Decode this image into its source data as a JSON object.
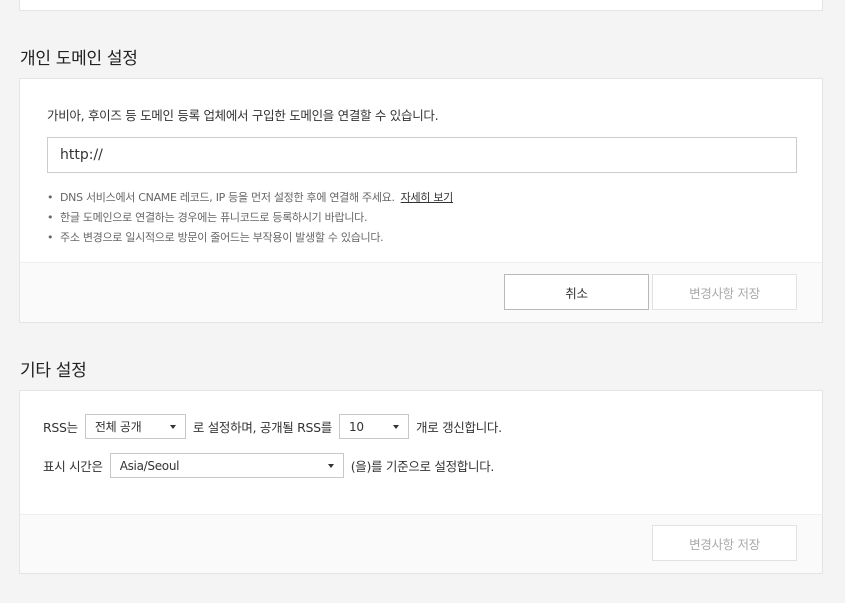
{
  "custom_domain": {
    "title": "개인 도메인 설정",
    "description": "가비아, 후이즈 등 도메인 등록 업체에서 구입한 도메인을 연결할 수 있습니다.",
    "url_value": "http://",
    "notes": [
      "DNS 서비스에서 CNAME 레코드, IP 등을 먼저 설정한 후에 연결해 주세요.",
      "한글 도메인으로 연결하는 경우에는 퓨니코드로 등록하시기 바랍니다.",
      "주소 변경으로 일시적으로 방문이 줄어드는 부작용이 발생할 수 있습니다."
    ],
    "details_link": "자세히 보기",
    "cancel_label": "취소",
    "save_label": "변경사항 저장"
  },
  "other_settings": {
    "title": "기타 설정",
    "rss_prefix": "RSS는",
    "rss_visibility": "전체 공개",
    "rss_middle": "로 설정하며, 공개될 RSS를",
    "rss_count": "10",
    "rss_suffix": "개로 갱신합니다.",
    "timezone_prefix": "표시 시간은",
    "timezone_value": "Asia/Seoul",
    "timezone_suffix": "(을)를 기준으로 설정합니다.",
    "save_label": "변경사항 저장"
  }
}
